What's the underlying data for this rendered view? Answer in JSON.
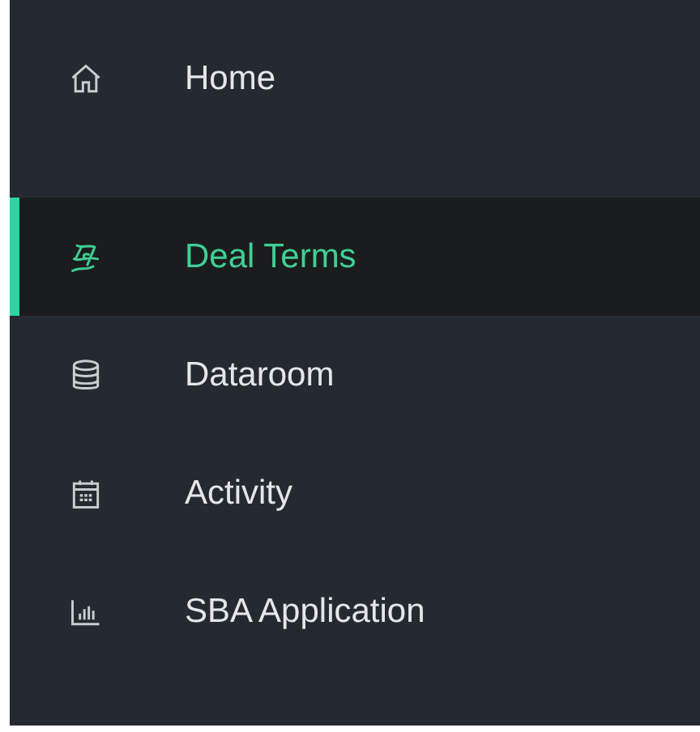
{
  "nav": {
    "items": [
      {
        "kind": "home",
        "label": "Home",
        "selected": false
      },
      {
        "kind": "deal",
        "label": "Deal Terms",
        "selected": true
      },
      {
        "kind": "database",
        "label": "Dataroom",
        "selected": false
      },
      {
        "kind": "calendar",
        "label": "Activity",
        "selected": false
      },
      {
        "kind": "chart",
        "label": "SBA Application",
        "selected": false
      }
    ]
  }
}
